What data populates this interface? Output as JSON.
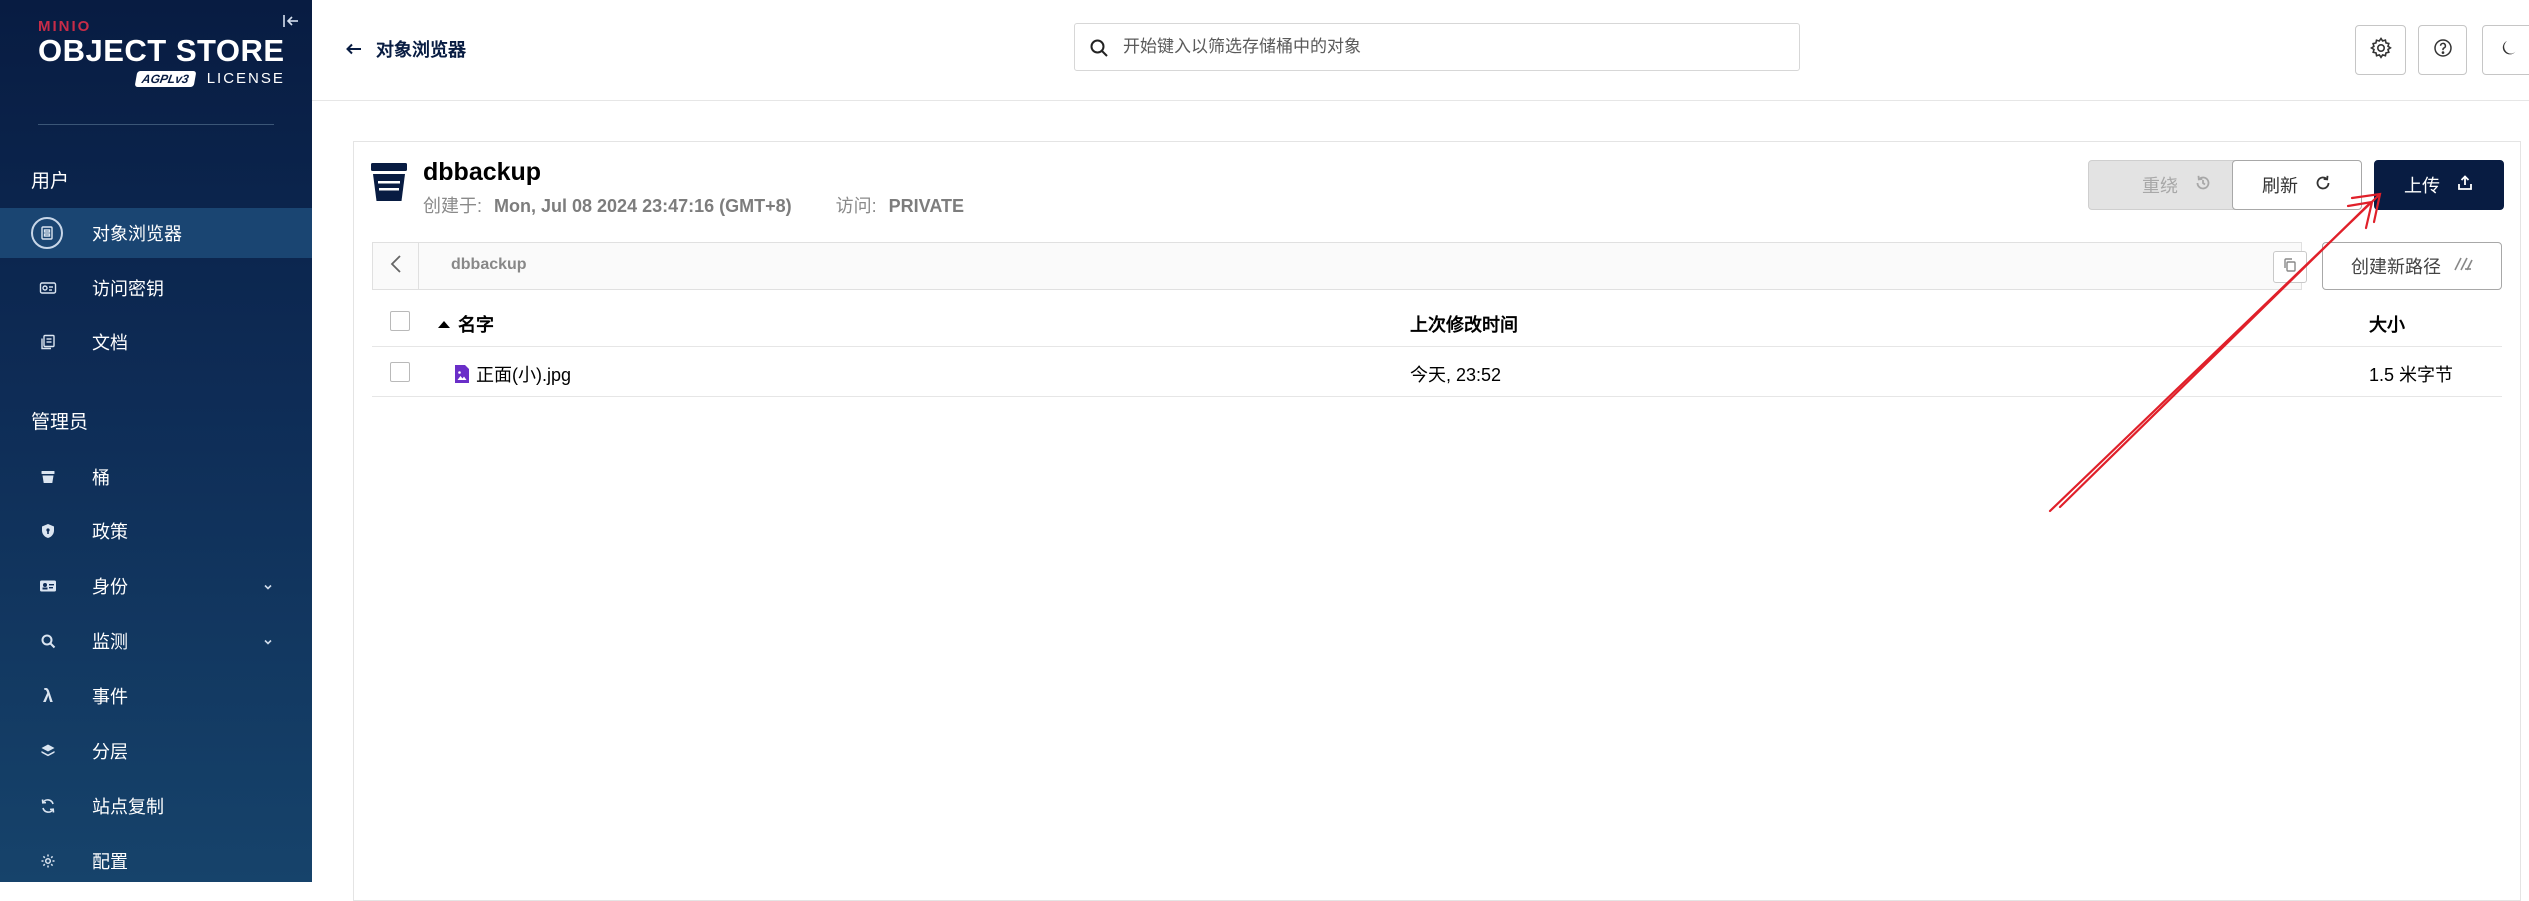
{
  "sidebar": {
    "brand_small": "MINIO",
    "brand_product": "OBJECT STORE",
    "brand_agpl": "AGPLv3",
    "brand_license": "LICENSE",
    "section_user": "用户",
    "section_admin": "管理员",
    "user_items": [
      {
        "label": "对象浏览器",
        "icon": "browser-icon",
        "active": true
      },
      {
        "label": "访问密钥",
        "icon": "key-icon"
      },
      {
        "label": "文档",
        "icon": "docs-icon"
      }
    ],
    "admin_items": [
      {
        "label": "桶",
        "icon": "bucket-icon"
      },
      {
        "label": "政策",
        "icon": "shield-icon"
      },
      {
        "label": "身份",
        "icon": "id-card-icon",
        "expandable": true
      },
      {
        "label": "监测",
        "icon": "monitor-icon",
        "expandable": true
      },
      {
        "label": "事件",
        "icon": "lambda-icon"
      },
      {
        "label": "分层",
        "icon": "layers-icon"
      },
      {
        "label": "站点复制",
        "icon": "sync-icon"
      },
      {
        "label": "配置",
        "icon": "gear-icon"
      }
    ]
  },
  "topbar": {
    "back_label": "对象浏览器",
    "search_placeholder": "开始键入以筛选存储桶中的对象"
  },
  "bucket": {
    "name": "dbbackup",
    "created_label": "创建于:",
    "created_value": "Mon, Jul 08 2024 23:47:16 (GMT+8)",
    "access_label": "访问:",
    "access_value": "PRIVATE"
  },
  "actions": {
    "rewind": "重绕",
    "refresh": "刷新",
    "upload": "上传",
    "create_path": "创建新路径"
  },
  "path": {
    "current": "dbbackup"
  },
  "table": {
    "columns": {
      "name": "名字",
      "modified": "上次修改时间",
      "size": "大小"
    },
    "rows": [
      {
        "name": "正面(小).jpg",
        "modified": "今天, 23:52",
        "size": "1.5 米字节"
      }
    ]
  },
  "colors": {
    "sidebar_bg": "#081c42",
    "primary": "#081c42",
    "annotation_arrow": "#e0202a"
  }
}
